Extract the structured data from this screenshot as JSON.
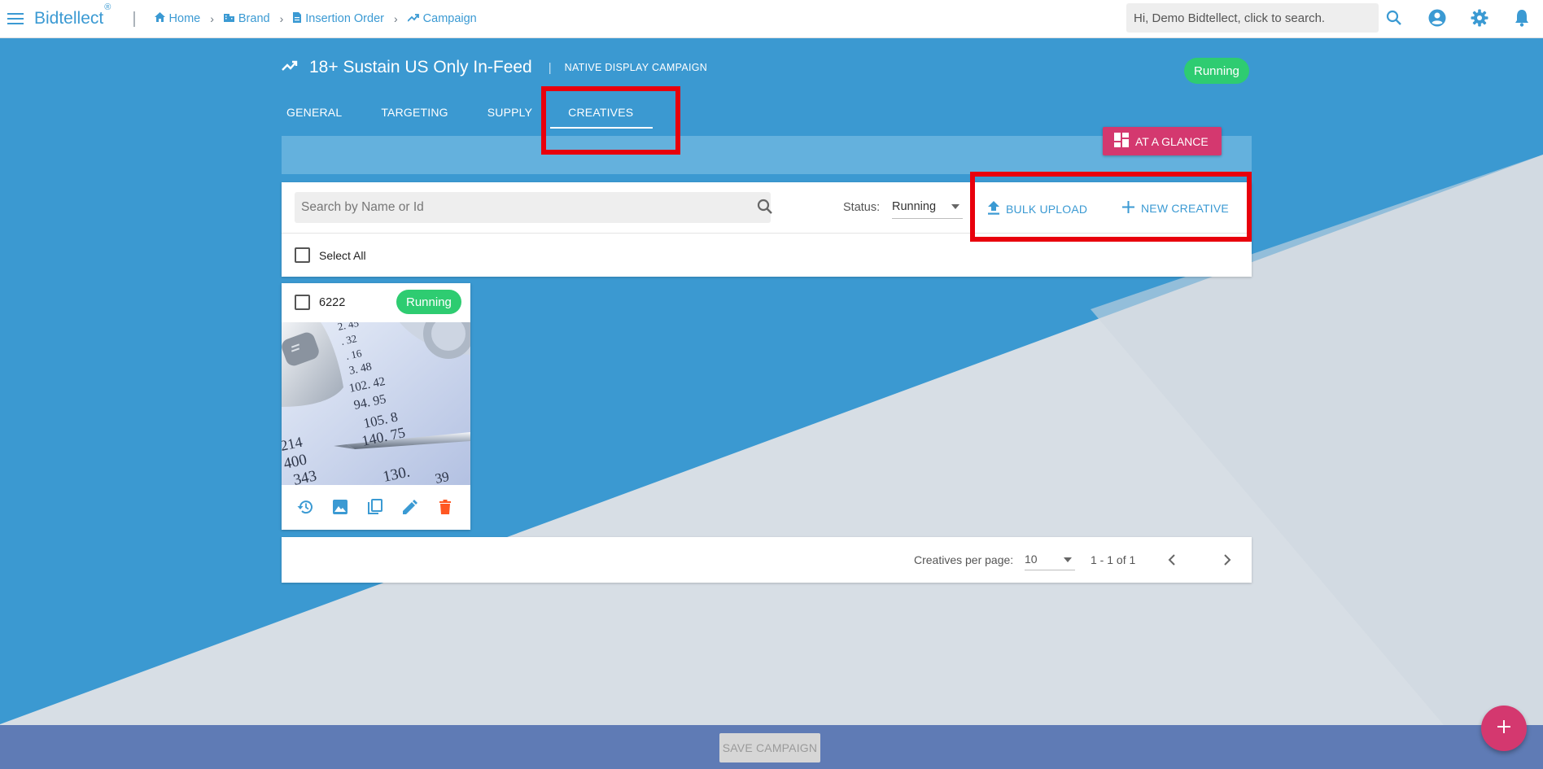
{
  "app": {
    "brand": "Bidtellect",
    "brand_mark": "®"
  },
  "breadcrumbs": [
    {
      "label": "Home",
      "icon": "home-icon"
    },
    {
      "label": "Brand",
      "icon": "brand-icon"
    },
    {
      "label": "Insertion Order",
      "icon": "document-icon"
    },
    {
      "label": "Campaign",
      "icon": "trending-icon"
    }
  ],
  "topbar": {
    "search_placeholder": "Hi, Demo Bidtellect, click to search.",
    "icons": [
      "search-icon",
      "account-icon",
      "settings-icon",
      "notifications-icon"
    ]
  },
  "campaign": {
    "title": "18+ Sustain US Only In-Feed",
    "divider": "|",
    "type": "NATIVE DISPLAY CAMPAIGN",
    "status": "Running"
  },
  "tabs": [
    {
      "label": "GENERAL",
      "active": false
    },
    {
      "label": "TARGETING",
      "active": false
    },
    {
      "label": "SUPPLY",
      "active": false
    },
    {
      "label": "CREATIVES",
      "active": true
    }
  ],
  "glance_button": "AT A GLANCE",
  "toolbar": {
    "search_placeholder": "Search by Name or Id",
    "status_label": "Status:",
    "status_value": "Running",
    "bulk_upload": "BULK UPLOAD",
    "new_creative": "NEW CREATIVE",
    "select_all": "Select All"
  },
  "creatives": [
    {
      "id": "6222",
      "status": "Running",
      "image_labels": [
        "2. 45",
        ". 32",
        ". 16",
        "3. 48",
        "102. 42",
        "94. 95",
        "105. 8",
        "140. 75",
        "214",
        "400",
        "343",
        "130.",
        "39"
      ],
      "actions": [
        "history-icon",
        "image-icon",
        "copy-icon",
        "edit-icon",
        "delete-icon"
      ]
    }
  ],
  "pagination": {
    "per_page_label": "Creatives per page:",
    "per_page_value": "10",
    "range": "1 - 1 of 1"
  },
  "footer": {
    "save_label": "SAVE CAMPAIGN"
  },
  "colors": {
    "primary_blue": "#3b99d1",
    "link_blue": "#3b9ad3",
    "running_green": "#2ecc71",
    "accent_pink": "#d4386f",
    "highlight_red": "#e8000c",
    "footer_blue": "#5f7bb5",
    "delete_orange": "#ff5722"
  }
}
